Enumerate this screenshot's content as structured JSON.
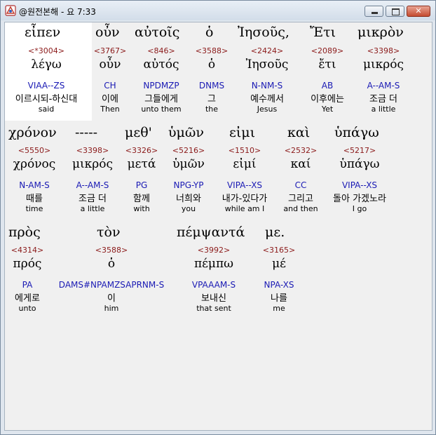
{
  "window": {
    "title": "@원전본해 - 요 7:33",
    "minimize_label": "_",
    "maximize_label": "□",
    "close_label": "✕"
  },
  "rows": [
    {
      "words": [
        {
          "greek": "εἶπεν",
          "strong": "<*3004>",
          "lemma": "λέγω",
          "parse": "VIAA--ZS",
          "korean": "이르시되-하신대",
          "english": "said"
        },
        {
          "greek": "οὖν",
          "strong": "<3767>",
          "lemma": "οὖν",
          "parse": "CH",
          "korean": "이에",
          "english": "Then"
        },
        {
          "greek": "αὐτοῖς",
          "strong": "<846>",
          "lemma": "αὐτός",
          "parse": "NPDMZP",
          "korean": "그들에게",
          "english": "unto them"
        },
        {
          "greek": "ὁ",
          "strong": "<3588>",
          "lemma": "ὁ",
          "parse": "DNMS",
          "korean": "그",
          "english": "the"
        },
        {
          "greek": "Ἰησοῦς,",
          "strong": "<2424>",
          "lemma": "Ἰησοῦς",
          "parse": "N-NM-S",
          "korean": "예수께서",
          "english": "Jesus"
        },
        {
          "greek": "Ἔτι",
          "strong": "<2089>",
          "lemma": "ἔτι",
          "parse": "AB",
          "korean": "이후에는",
          "english": "Yet"
        },
        {
          "greek": "μικρὸν",
          "strong": "<3398>",
          "lemma": "μικρός",
          "parse": "A--AM-S",
          "korean": "조금 더",
          "english": "a little"
        }
      ]
    },
    {
      "words": [
        {
          "greek": "χρόνον",
          "strong": "<5550>",
          "lemma": "χρόνος",
          "parse": "N-AM-S",
          "korean": "때를",
          "english": "time"
        },
        {
          "greek": "-----",
          "strong": "<3398>",
          "lemma": "μικρός",
          "parse": "A--AM-S",
          "korean": "조금 더",
          "english": "a little"
        },
        {
          "greek": "μεθ'",
          "strong": "<3326>",
          "lemma": "μετά",
          "parse": "PG",
          "korean": "함께",
          "english": "with"
        },
        {
          "greek": "ὑμῶν",
          "strong": "<5216>",
          "lemma": "ὑμῶν",
          "parse": "NPG-YP",
          "korean": "너희와",
          "english": "you"
        },
        {
          "greek": "εἰμι",
          "strong": "<1510>",
          "lemma": "εἰμί",
          "parse": "VIPA--XS",
          "korean": "내가-있다가",
          "english": "while am I"
        },
        {
          "greek": "καὶ",
          "strong": "<2532>",
          "lemma": "καί",
          "parse": "CC",
          "korean": "그리고",
          "english": "and then"
        },
        {
          "greek": "ὑπάγω",
          "strong": "<5217>",
          "lemma": "ὑπάγω",
          "parse": "VIPA--XS",
          "korean": "돌아 가겠노라",
          "english": "I go"
        }
      ]
    },
    {
      "words": [
        {
          "greek": "πρὸς",
          "strong": "<4314>",
          "lemma": "πρός",
          "parse": "PA",
          "korean": "에게로",
          "english": "unto"
        },
        {
          "greek": "τὸν",
          "strong": "<3588>",
          "lemma": "ὁ",
          "parse": "DAMS#NPAMZSAPRNM-S",
          "korean": "이",
          "english": "him"
        },
        {
          "greek": "πέμψαντά",
          "strong": "<3992>",
          "lemma": "πέμπω",
          "parse": "VPAAAM-S",
          "korean": "보내신",
          "english": "that sent"
        },
        {
          "greek": "με.",
          "strong": "<3165>",
          "lemma": "μέ",
          "parse": "NPA-XS",
          "korean": "나를",
          "english": "me"
        }
      ]
    }
  ]
}
